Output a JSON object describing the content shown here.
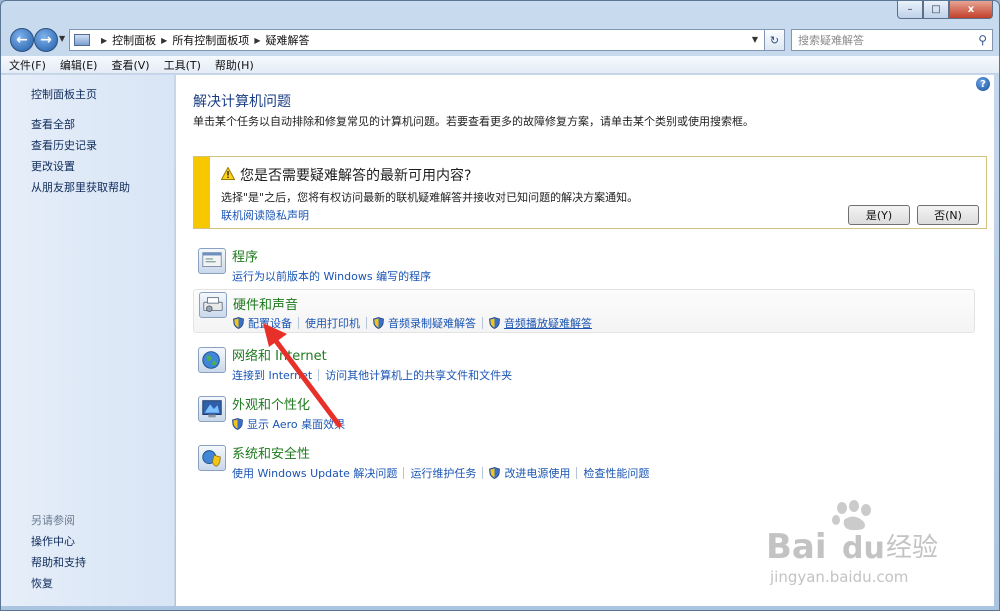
{
  "window": {
    "minimize": "–",
    "maximize": "□",
    "close": "x"
  },
  "address": {
    "crumbs": [
      "控制面板",
      "所有控制面板项",
      "疑难解答"
    ],
    "search_placeholder": "搜索疑难解答"
  },
  "menu": [
    "文件(F)",
    "编辑(E)",
    "查看(V)",
    "工具(T)",
    "帮助(H)"
  ],
  "sidebar": {
    "home": "控制面板主页",
    "links": [
      "查看全部",
      "查看历史记录",
      "更改设置",
      "从朋友那里获取帮助"
    ],
    "see_also_title": "另请参阅",
    "see_also": [
      "操作中心",
      "帮助和支持",
      "恢复"
    ]
  },
  "main": {
    "title": "解决计算机问题",
    "description": "单击某个任务以自动排除和修复常见的计算机问题。若要查看更多的故障修复方案，请单击某个类别或使用搜索框。",
    "help": "?"
  },
  "notice": {
    "title": "您是否需要疑难解答的最新可用内容?",
    "text": "选择\"是\"之后，您将有权访问最新的联机疑难解答并接收对已知问题的解决方案通知。",
    "privacy_link": "联机阅读隐私声明",
    "yes": "是(Y)",
    "no": "否(N)"
  },
  "categories": [
    {
      "title": "程序",
      "links": [
        "运行为以前版本的 Windows 编写的程序"
      ]
    },
    {
      "title": "硬件和声音",
      "links": [
        "配置设备",
        "使用打印机",
        "音频录制疑难解答",
        "音频播放疑难解答"
      ]
    },
    {
      "title": "网络和 Internet",
      "links": [
        "连接到 Internet",
        "访问其他计算机上的共享文件和文件夹"
      ]
    },
    {
      "title": "外观和个性化",
      "links": [
        "显示 Aero 桌面效果"
      ]
    },
    {
      "title": "系统和安全性",
      "links": [
        "使用 Windows Update 解决问题",
        "运行维护任务",
        "改进电源使用",
        "检查性能问题"
      ]
    }
  ],
  "watermark": {
    "brand": "Bai",
    "brand2": "du",
    "cn": "经验",
    "url": "jingyan.baidu.com"
  },
  "colors": {
    "accent": "#1a55b4",
    "category": "#1e7a1e",
    "warning": "#f7c700",
    "annotation": "#e8302a"
  }
}
